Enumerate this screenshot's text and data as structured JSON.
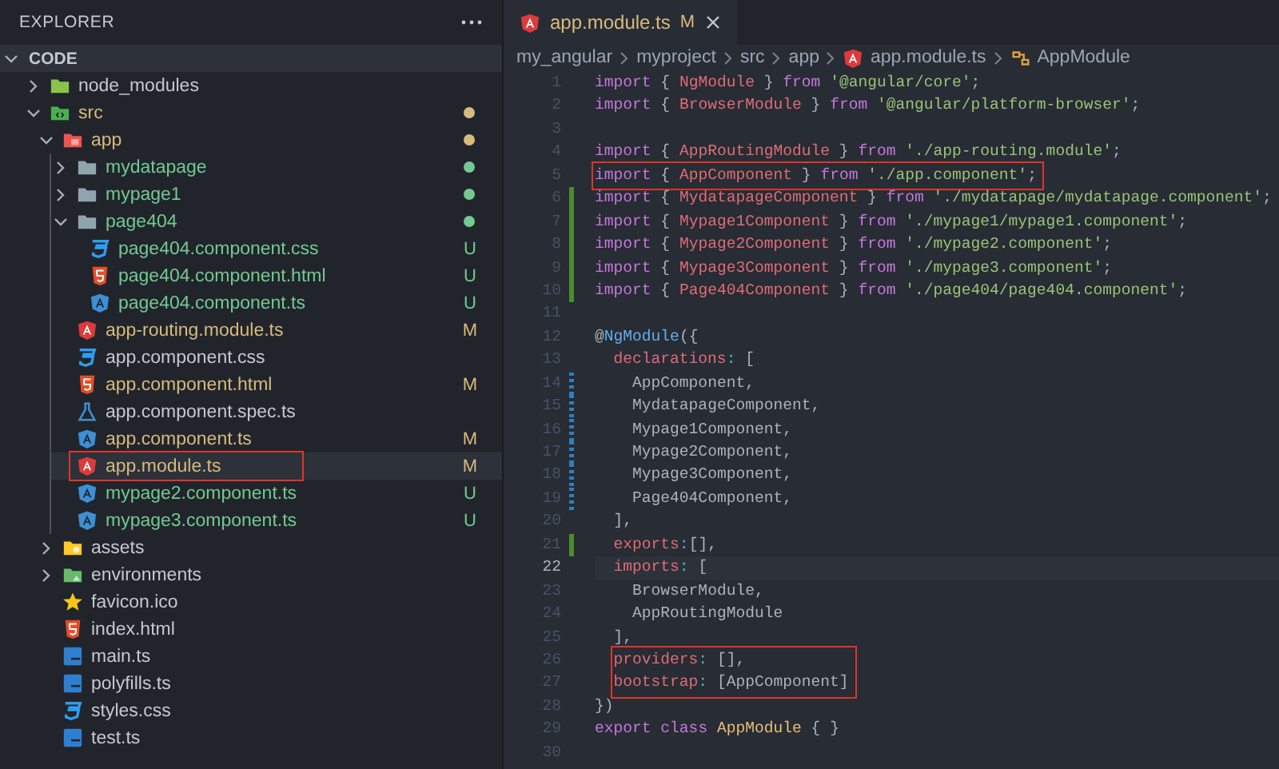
{
  "sidebar": {
    "title": "EXPLORER",
    "section": {
      "label": "CODE",
      "expanded": true
    },
    "tree": [
      {
        "name": "node_modules",
        "kind": "nodefolder",
        "expanded": false
      },
      {
        "name": "src",
        "kind": "srcfolder",
        "expanded": true,
        "color": "#d7ba7d",
        "children": [
          {
            "name": "app",
            "kind": "appfolder",
            "expanded": true,
            "color": "#d7ba7d",
            "children": [
              {
                "name": "mydatapage",
                "kind": "folder",
                "expanded": false,
                "color": "#73c991"
              },
              {
                "name": "mypage1",
                "kind": "folder",
                "expanded": false,
                "color": "#73c991"
              },
              {
                "name": "page404",
                "kind": "folder",
                "expanded": true,
                "color": "#73c991",
                "children": [
                  {
                    "name": "page404.component.css",
                    "kind": "stylesheet",
                    "color": "#73c991",
                    "badge": "U",
                    "selected": false
                  },
                  {
                    "name": "page404.component.html",
                    "kind": "markup",
                    "color": "#73c991",
                    "badge": "U",
                    "selected": false
                  },
                  {
                    "name": "page404.component.ts",
                    "kind": "component",
                    "color": "#73c991",
                    "badge": "U",
                    "selected": false
                  }
                ]
              },
              {
                "name": "app-routing.module.ts",
                "kind": "module",
                "color": "#d7ba7d",
                "badge": "M",
                "selected": false
              },
              {
                "name": "app.component.css",
                "kind": "stylesheet",
                "selected": false
              },
              {
                "name": "app.component.html",
                "kind": "markup",
                "color": "#d7ba7d",
                "badge": "M",
                "selected": false
              },
              {
                "name": "app.component.spec.ts",
                "kind": "spec",
                "selected": false
              },
              {
                "name": "app.component.ts",
                "kind": "component",
                "color": "#d7ba7d",
                "badge": "M",
                "selected": false
              },
              {
                "name": "app.module.ts",
                "kind": "module",
                "color": "#d7ba7d",
                "badge": "M",
                "selected": true,
                "boxed": true
              },
              {
                "name": "mypage2.component.ts",
                "kind": "component",
                "color": "#73c991",
                "badge": "U",
                "selected": false
              },
              {
                "name": "mypage3.component.ts",
                "kind": "component",
                "color": "#73c991",
                "badge": "U",
                "selected": false
              }
            ]
          },
          {
            "name": "assets",
            "kind": "assetsfolder",
            "expanded": false
          },
          {
            "name": "environments",
            "kind": "envfolder",
            "expanded": false
          },
          {
            "name": "favicon.ico",
            "kind": "favicon",
            "selected": false
          },
          {
            "name": "index.html",
            "kind": "markup",
            "selected": false
          },
          {
            "name": "main.ts",
            "kind": "script",
            "selected": false
          },
          {
            "name": "polyfills.ts",
            "kind": "script",
            "selected": false
          },
          {
            "name": "styles.css",
            "kind": "stylesheet",
            "selected": false
          },
          {
            "name": "test.ts",
            "kind": "script",
            "selected": false
          }
        ]
      }
    ]
  },
  "editor": {
    "tabs": [
      {
        "label": "app.module.ts",
        "kind": "module",
        "status": "M",
        "selected": true
      }
    ],
    "breadcrumb": [
      {
        "label": "my_angular",
        "kind": "plain"
      },
      {
        "label": "myproject",
        "kind": "plain"
      },
      {
        "label": "src",
        "kind": "plain"
      },
      {
        "label": "app",
        "kind": "plain"
      },
      {
        "label": "app.module.ts",
        "kind": "module"
      },
      {
        "label": "AppModule",
        "kind": "symbol"
      }
    ],
    "lines": [
      {
        "number": "1",
        "kind": "import",
        "added": false,
        "edited": false,
        "current": false,
        "boxed": false,
        "text": "import { NgModule } from '@angular/core';"
      },
      {
        "number": "2",
        "kind": "import",
        "added": false,
        "edited": false,
        "current": false,
        "boxed": false,
        "text": "import { BrowserModule } from '@angular/platform-browser';"
      },
      {
        "number": "3",
        "kind": "blank",
        "added": false,
        "edited": false,
        "current": false,
        "boxed": false
      },
      {
        "number": "4",
        "kind": "import",
        "added": false,
        "edited": false,
        "current": false,
        "boxed": false,
        "text": "import { AppRoutingModule } from './app-routing.module';"
      },
      {
        "number": "5",
        "kind": "import",
        "added": false,
        "edited": false,
        "current": false,
        "boxed": true,
        "text": "import { AppComponent } from './app.component';"
      },
      {
        "number": "6",
        "kind": "import",
        "added": true,
        "edited": false,
        "current": false,
        "boxed": false,
        "text": "import { MydatapageComponent } from './mydatapage/mydatapage.component';"
      },
      {
        "number": "7",
        "kind": "import",
        "added": true,
        "edited": false,
        "current": false,
        "boxed": false,
        "text": "import { Mypage1Component } from './mypage1/mypage1.component';"
      },
      {
        "number": "8",
        "kind": "import",
        "added": true,
        "edited": false,
        "current": false,
        "boxed": false,
        "text": "import { Mypage2Component } from './mypage2.component';"
      },
      {
        "number": "9",
        "kind": "import",
        "added": true,
        "edited": false,
        "current": false,
        "boxed": false,
        "text": "import { Mypage3Component } from './mypage3.component';"
      },
      {
        "number": "10",
        "kind": "import",
        "added": true,
        "edited": false,
        "current": false,
        "boxed": false,
        "text": "import { Page404Component } from './page404/page404.component';"
      },
      {
        "number": "11",
        "kind": "blank",
        "added": false,
        "edited": false,
        "current": false,
        "boxed": false
      },
      {
        "number": "12",
        "kind": "decorator",
        "added": false,
        "edited": false,
        "current": false,
        "boxed": false,
        "text": "@NgModule({"
      },
      {
        "number": "13",
        "kind": "property",
        "added": false,
        "edited": false,
        "current": false,
        "boxed": false,
        "text": "  declarations: ["
      },
      {
        "number": "14",
        "kind": "plain",
        "added": false,
        "edited": true,
        "current": false,
        "boxed": false,
        "text": "    AppComponent,"
      },
      {
        "number": "15",
        "kind": "plain",
        "added": false,
        "edited": true,
        "current": false,
        "boxed": false,
        "text": "    MydatapageComponent,"
      },
      {
        "number": "16",
        "kind": "plain",
        "added": false,
        "edited": true,
        "current": false,
        "boxed": false,
        "text": "    Mypage1Component,"
      },
      {
        "number": "17",
        "kind": "plain",
        "added": false,
        "edited": true,
        "current": false,
        "boxed": false,
        "text": "    Mypage2Component,"
      },
      {
        "number": "18",
        "kind": "plain",
        "added": false,
        "edited": true,
        "current": false,
        "boxed": false,
        "text": "    Mypage3Component,"
      },
      {
        "number": "19",
        "kind": "plain",
        "added": false,
        "edited": true,
        "current": false,
        "boxed": false,
        "text": "    Page404Component,"
      },
      {
        "number": "20",
        "kind": "plain",
        "added": false,
        "edited": false,
        "current": false,
        "boxed": false,
        "text": "  ],"
      },
      {
        "number": "21",
        "kind": "property",
        "added": true,
        "edited": false,
        "current": false,
        "boxed": false,
        "text": "  exports:[],"
      },
      {
        "number": "22",
        "kind": "property",
        "added": false,
        "edited": false,
        "current": true,
        "boxed": false,
        "text": "  imports: ["
      },
      {
        "number": "23",
        "kind": "plain",
        "added": false,
        "edited": false,
        "current": false,
        "boxed": false,
        "text": "    BrowserModule,"
      },
      {
        "number": "24",
        "kind": "plain",
        "added": false,
        "edited": false,
        "current": false,
        "boxed": false,
        "text": "    AppRoutingModule"
      },
      {
        "number": "25",
        "kind": "plain",
        "added": false,
        "edited": false,
        "current": false,
        "boxed": false,
        "text": "  ],"
      },
      {
        "number": "26",
        "kind": "property",
        "added": false,
        "edited": false,
        "current": false,
        "boxed": true,
        "text": "  providers: [],"
      },
      {
        "number": "27",
        "kind": "property",
        "added": false,
        "edited": false,
        "current": false,
        "boxed": true,
        "text": "  bootstrap: [AppComponent]"
      },
      {
        "number": "28",
        "kind": "plain",
        "added": false,
        "edited": false,
        "current": false,
        "boxed": false,
        "text": "})"
      },
      {
        "number": "29",
        "kind": "class",
        "added": false,
        "edited": false,
        "current": false,
        "boxed": false,
        "text": "export class AppModule { }"
      },
      {
        "number": "30",
        "kind": "blank",
        "added": false,
        "edited": false,
        "current": false,
        "boxed": false
      }
    ]
  }
}
